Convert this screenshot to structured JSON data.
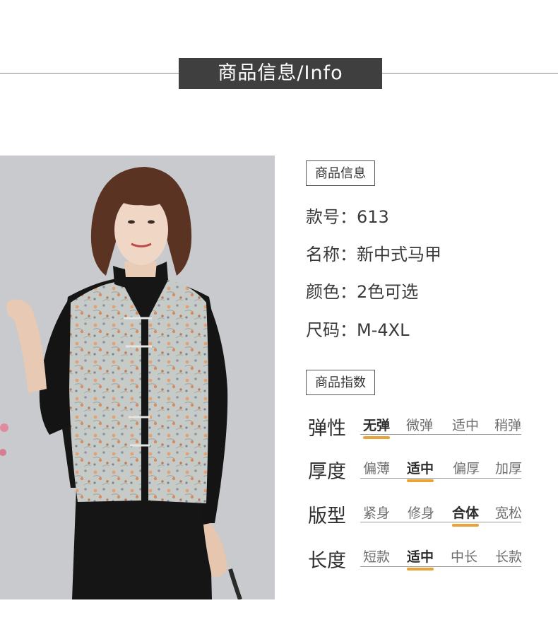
{
  "header": {
    "title": "商品信息/Info"
  },
  "photo": {
    "alt": ""
  },
  "info": {
    "section_title": "商品信息",
    "rows": [
      {
        "label": "款号",
        "value": "613"
      },
      {
        "label": "名称",
        "value": "新中式马甲"
      },
      {
        "label": "颜色",
        "value": "2色可选"
      },
      {
        "label": "尺码",
        "value": "M-4XL"
      }
    ],
    "separator": "："
  },
  "index": {
    "section_title": "商品指数",
    "accent_color": "#e8a33a",
    "rows": [
      {
        "label": "弹性",
        "options": [
          "无弹",
          "微弹",
          "适中",
          "稍弹"
        ],
        "selected": 0
      },
      {
        "label": "厚度",
        "options": [
          "偏薄",
          "适中",
          "偏厚",
          "加厚"
        ],
        "selected": 1
      },
      {
        "label": "版型",
        "options": [
          "紧身",
          "修身",
          "合体",
          "宽松"
        ],
        "selected": 2
      },
      {
        "label": "长度",
        "options": [
          "短款",
          "适中",
          "中长",
          "长款"
        ],
        "selected": 1
      }
    ]
  }
}
